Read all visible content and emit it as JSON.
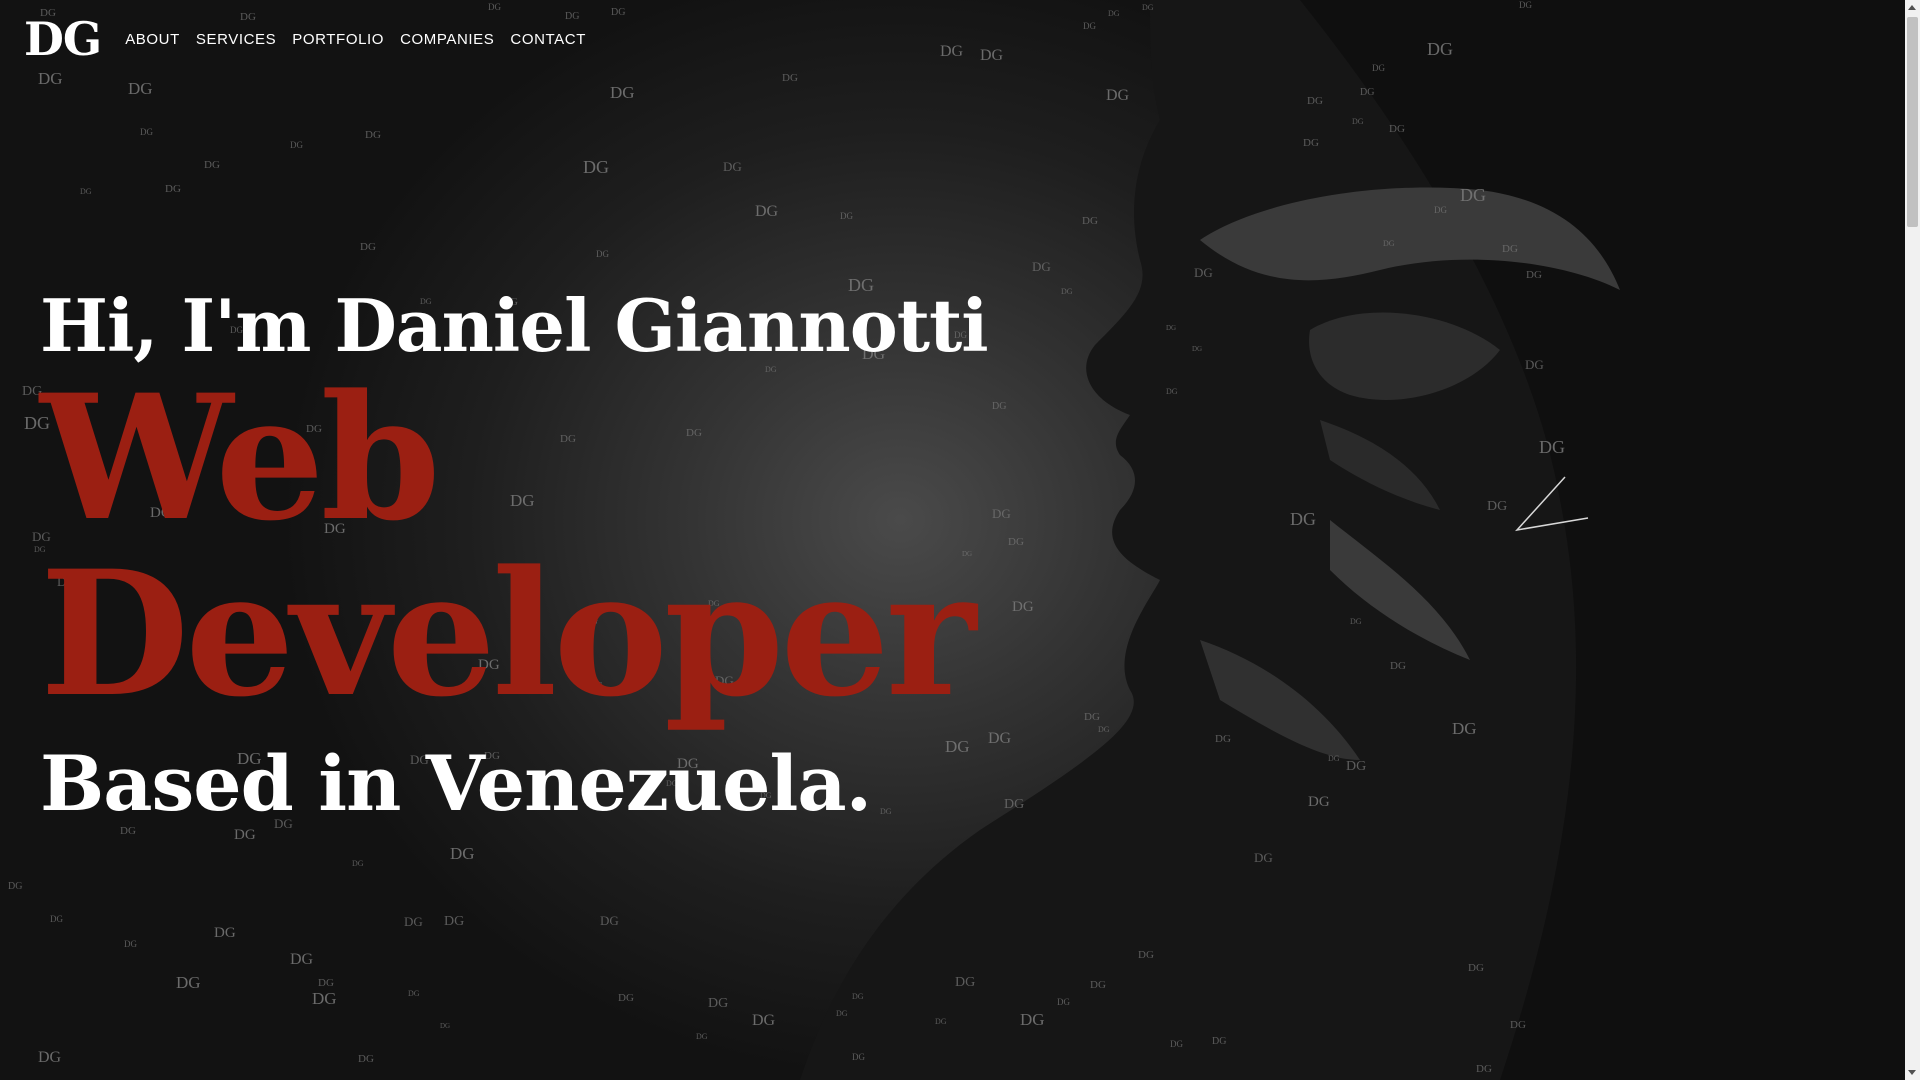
{
  "header": {
    "logo": "DG",
    "nav": [
      "ABOUT",
      "SERVICES",
      "PORTFOLIO",
      "COMPANIES",
      "CONTACT"
    ]
  },
  "hero": {
    "greeting": "Hi, I'm Daniel Giannotti",
    "role_line1": "Web",
    "role_line2": "Developer",
    "location": "Based in Venezuela."
  },
  "background": {
    "watermark_text": "DG"
  },
  "colors": {
    "accent": "#9b1f12",
    "text": "#ffffff",
    "watermark": "#7a7a7a"
  }
}
